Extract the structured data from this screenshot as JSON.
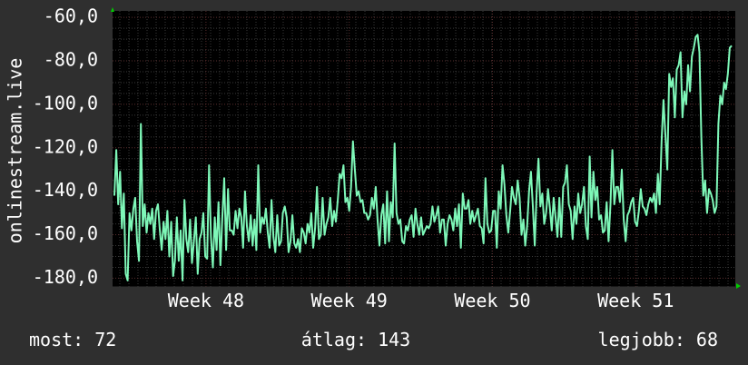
{
  "chart_data": {
    "type": "line",
    "ylabel": "onlinestream.live",
    "ylim": [
      -184,
      -57
    ],
    "y_ticks": [
      {
        "value": -60,
        "label": "-60,0"
      },
      {
        "value": -80,
        "label": "-80,0"
      },
      {
        "value": -100,
        "label": "-100,0"
      },
      {
        "value": -120,
        "label": "-120,0"
      },
      {
        "value": -140,
        "label": "-140,0"
      },
      {
        "value": -160,
        "label": "-160,0"
      },
      {
        "value": -180,
        "label": "-180,0"
      }
    ],
    "x_ticks": [
      {
        "pos": 0.15,
        "label": "Week 48"
      },
      {
        "pos": 0.38,
        "label": "Week 49"
      },
      {
        "pos": 0.61,
        "label": "Week 50"
      },
      {
        "pos": 0.84,
        "label": "Week 51"
      }
    ],
    "grid": true,
    "colors": {
      "line": "#7ef7b8",
      "background": "#000000",
      "frame": "#2f2f2f",
      "grid": "#3a3a3a",
      "grid_accent": "#5a2e2e",
      "arrow": "#00cc00"
    },
    "series": [
      {
        "values": [
          -142,
          -121,
          -146,
          -131,
          -157,
          -141,
          -178,
          -181,
          -150,
          -158,
          -148,
          -143,
          -163,
          -172,
          -109,
          -156,
          -146,
          -159,
          -150,
          -155,
          -148,
          -162,
          -149,
          -146,
          -158,
          -167,
          -154,
          -162,
          -149,
          -170,
          -154,
          -179,
          -172,
          -152,
          -172,
          -158,
          -181,
          -144,
          -162,
          -168,
          -153,
          -173,
          -163,
          -152,
          -178,
          -162,
          -159,
          -150,
          -170,
          -171,
          -128,
          -161,
          -175,
          -152,
          -167,
          -145,
          -174,
          -152,
          -134,
          -167,
          -139,
          -158,
          -158,
          -160,
          -149,
          -157,
          -148,
          -152,
          -166,
          -140,
          -156,
          -163,
          -151,
          -165,
          -153,
          -167,
          -128,
          -159,
          -152,
          -155,
          -148,
          -159,
          -166,
          -144,
          -161,
          -168,
          -151,
          -165,
          -163,
          -150,
          -147,
          -152,
          -168,
          -163,
          -151,
          -164,
          -166,
          -162,
          -168,
          -157,
          -159,
          -164,
          -155,
          -159,
          -150,
          -166,
          -157,
          -138,
          -162,
          -160,
          -143,
          -160,
          -155,
          -152,
          -143,
          -156,
          -149,
          -154,
          -144,
          -132,
          -134,
          -128,
          -145,
          -143,
          -149,
          -138,
          -117,
          -130,
          -142,
          -140,
          -145,
          -144,
          -150,
          -150,
          -153,
          -151,
          -143,
          -148,
          -138,
          -153,
          -165,
          -151,
          -146,
          -164,
          -140,
          -163,
          -145,
          -152,
          -118,
          -150,
          -155,
          -153,
          -163,
          -164,
          -156,
          -158,
          -153,
          -151,
          -161,
          -148,
          -155,
          -160,
          -152,
          -160,
          -158,
          -156,
          -157,
          -155,
          -147,
          -154,
          -151,
          -147,
          -159,
          -153,
          -153,
          -165,
          -155,
          -151,
          -153,
          -158,
          -148,
          -156,
          -146,
          -166,
          -141,
          -148,
          -148,
          -144,
          -155,
          -149,
          -154,
          -151,
          -148,
          -156,
          -157,
          -164,
          -134,
          -155,
          -159,
          -158,
          -149,
          -149,
          -166,
          -140,
          -148,
          -128,
          -137,
          -151,
          -159,
          -149,
          -138,
          -143,
          -146,
          -135,
          -143,
          -160,
          -153,
          -165,
          -156,
          -140,
          -131,
          -147,
          -165,
          -140,
          -125,
          -147,
          -141,
          -155,
          -150,
          -139,
          -148,
          -158,
          -143,
          -152,
          -161,
          -143,
          -161,
          -138,
          -136,
          -128,
          -146,
          -149,
          -162,
          -147,
          -155,
          -141,
          -150,
          -146,
          -138,
          -156,
          -162,
          -124,
          -152,
          -131,
          -144,
          -138,
          -153,
          -151,
          -159,
          -158,
          -145,
          -163,
          -146,
          -121,
          -146,
          -138,
          -138,
          -145,
          -130,
          -153,
          -163,
          -151,
          -149,
          -145,
          -143,
          -154,
          -156,
          -149,
          -139,
          -147,
          -148,
          -151,
          -146,
          -143,
          -145,
          -141,
          -150,
          -132,
          -146,
          -117,
          -98,
          -114,
          -130,
          -86,
          -92,
          -88,
          -106,
          -84,
          -82,
          -76,
          -106,
          -94,
          -100,
          -82,
          -94,
          -78,
          -74,
          -69,
          -68,
          -76,
          -115,
          -142,
          -135,
          -150,
          -139,
          -141,
          -144,
          -150,
          -147,
          -109,
          -96,
          -100,
          -90,
          -93,
          -86,
          -74,
          -73
        ]
      }
    ]
  },
  "footer": {
    "current": "most: 72",
    "average": "átlag: 143",
    "best": "legjobb: 68"
  }
}
